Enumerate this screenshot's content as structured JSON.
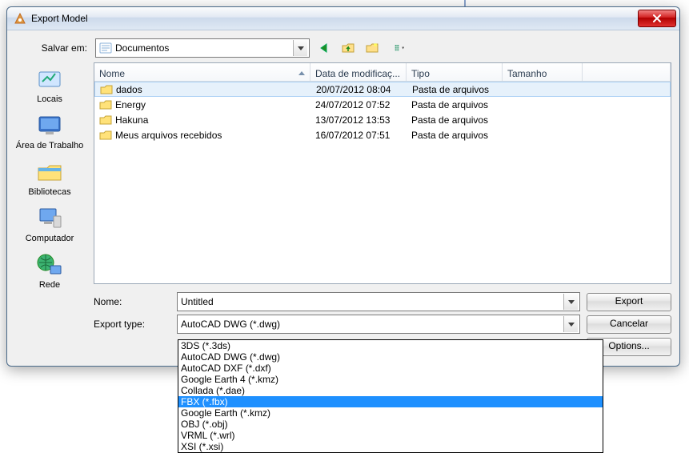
{
  "window": {
    "title": "Export Model"
  },
  "toprow": {
    "save_in_label": "Salvar em:",
    "current_folder": "Documentos"
  },
  "toolbar_icons": {
    "back": "back-arrow-icon",
    "up": "up-folder-icon",
    "newfolder": "new-folder-icon",
    "viewmenu": "view-menu-icon"
  },
  "places": [
    {
      "label": "Locais"
    },
    {
      "label": "Área de Trabalho"
    },
    {
      "label": "Bibliotecas"
    },
    {
      "label": "Computador"
    },
    {
      "label": "Rede"
    }
  ],
  "columns": {
    "name": "Nome",
    "date": "Data de modificaç...",
    "type": "Tipo",
    "size": "Tamanho"
  },
  "files": [
    {
      "name": "dados",
      "date": "20/07/2012 08:04",
      "type": "Pasta de arquivos",
      "size": "",
      "selected": true
    },
    {
      "name": "Energy",
      "date": "24/07/2012 07:52",
      "type": "Pasta de arquivos",
      "size": ""
    },
    {
      "name": "Hakuna",
      "date": "13/07/2012 13:53",
      "type": "Pasta de arquivos",
      "size": ""
    },
    {
      "name": "Meus arquivos recebidos",
      "date": "16/07/2012 07:51",
      "type": "Pasta de arquivos",
      "size": ""
    }
  ],
  "fields": {
    "name_label": "Nome:",
    "name_value": "Untitled",
    "type_label": "Export type:",
    "type_value": "AutoCAD DWG (*.dwg)"
  },
  "buttons": {
    "export": "Export",
    "cancel": "Cancelar",
    "options": "Options..."
  },
  "dropdown": {
    "options": [
      "3DS (*.3ds)",
      "AutoCAD DWG (*.dwg)",
      "AutoCAD DXF (*.dxf)",
      "Google Earth 4 (*.kmz)",
      "Collada (*.dae)",
      "FBX (*.fbx)",
      "Google Earth (*.kmz)",
      "OBJ (*.obj)",
      "VRML (*.wrl)",
      "XSI (*.xsi)"
    ],
    "selected_index": 5
  }
}
